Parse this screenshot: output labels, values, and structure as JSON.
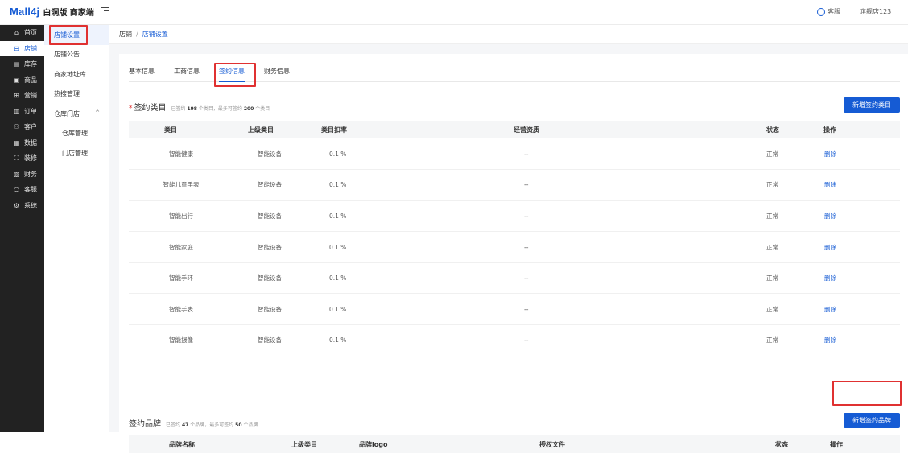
{
  "header": {
    "logo_brand": "Mall4j",
    "logo_sub": "白洞版 商家端",
    "kefu_label": "客服",
    "shop_name": "旗舰店123"
  },
  "sidebar": {
    "items": [
      {
        "icon": "home-icon",
        "glyph": "⌂",
        "label": "首页"
      },
      {
        "icon": "store-icon",
        "glyph": "⊟",
        "label": "店铺"
      },
      {
        "icon": "inventory-icon",
        "glyph": "▤",
        "label": "库存"
      },
      {
        "icon": "goods-icon",
        "glyph": "▣",
        "label": "商品"
      },
      {
        "icon": "marketing-icon",
        "glyph": "⊞",
        "label": "营销"
      },
      {
        "icon": "order-icon",
        "glyph": "▥",
        "label": "订单"
      },
      {
        "icon": "customer-icon",
        "glyph": "⚇",
        "label": "客户"
      },
      {
        "icon": "data-icon",
        "glyph": "▦",
        "label": "数据"
      },
      {
        "icon": "decorate-icon",
        "glyph": "⛶",
        "label": "装修"
      },
      {
        "icon": "finance-icon",
        "glyph": "▧",
        "label": "财务"
      },
      {
        "icon": "service-icon",
        "glyph": "○",
        "label": "客服"
      },
      {
        "icon": "settings-icon",
        "glyph": "⚙",
        "label": "系统"
      }
    ]
  },
  "subnav": {
    "items": [
      {
        "label": "店铺设置"
      },
      {
        "label": "店铺公告"
      },
      {
        "label": "商家地址库"
      },
      {
        "label": "热搜管理"
      },
      {
        "label": "仓库门店",
        "chevron": "^"
      },
      {
        "label": "仓库管理"
      },
      {
        "label": "门店管理"
      }
    ]
  },
  "breadcrumb": {
    "root": "店铺",
    "separator": "/",
    "current": "店铺设置"
  },
  "tabs": [
    "基本信息",
    "工商信息",
    "签约信息",
    "财务信息"
  ],
  "category_section": {
    "required_mark": "*",
    "title": "签约类目",
    "hint_prefix": "已签约",
    "hint_count": "198",
    "hint_mid": "个类目，最多可签约",
    "hint_max": "200",
    "hint_suffix": "个类目",
    "add_button": "新增签约类目",
    "columns": [
      "类目",
      "上级类目",
      "类目扣率",
      "经营资质",
      "状态",
      "操作"
    ],
    "rows": [
      {
        "category": "智能健康",
        "parent": "智能设备",
        "rate": "0.1 %",
        "qualification": "--",
        "status": "正常",
        "action": "删除"
      },
      {
        "category": "智能儿童手表",
        "parent": "智能设备",
        "rate": "0.1 %",
        "qualification": "--",
        "status": "正常",
        "action": "删除"
      },
      {
        "category": "智能出行",
        "parent": "智能设备",
        "rate": "0.1 %",
        "qualification": "--",
        "status": "正常",
        "action": "删除"
      },
      {
        "category": "智能家庭",
        "parent": "智能设备",
        "rate": "0.1 %",
        "qualification": "--",
        "status": "正常",
        "action": "删除"
      },
      {
        "category": "智能手环",
        "parent": "智能设备",
        "rate": "0.1 %",
        "qualification": "--",
        "status": "正常",
        "action": "删除"
      },
      {
        "category": "智能手表",
        "parent": "智能设备",
        "rate": "0.1 %",
        "qualification": "--",
        "status": "正常",
        "action": "删除"
      },
      {
        "category": "智能摄像",
        "parent": "智能设备",
        "rate": "0.1 %",
        "qualification": "--",
        "status": "正常",
        "action": "删除"
      }
    ]
  },
  "brand_section": {
    "title": "签约品牌",
    "hint_prefix": "已签约",
    "hint_count": "47",
    "hint_mid": "个品牌，最多可签约",
    "hint_max": "50",
    "hint_suffix": "个品牌",
    "add_button": "新增签约品牌",
    "columns": [
      "品牌名称",
      "上级类目",
      "品牌logo",
      "授权文件",
      "状态",
      "操作"
    ]
  },
  "colors": {
    "accent": "#155bd4",
    "highlight": "#e03131",
    "sidebar": "#222222"
  }
}
